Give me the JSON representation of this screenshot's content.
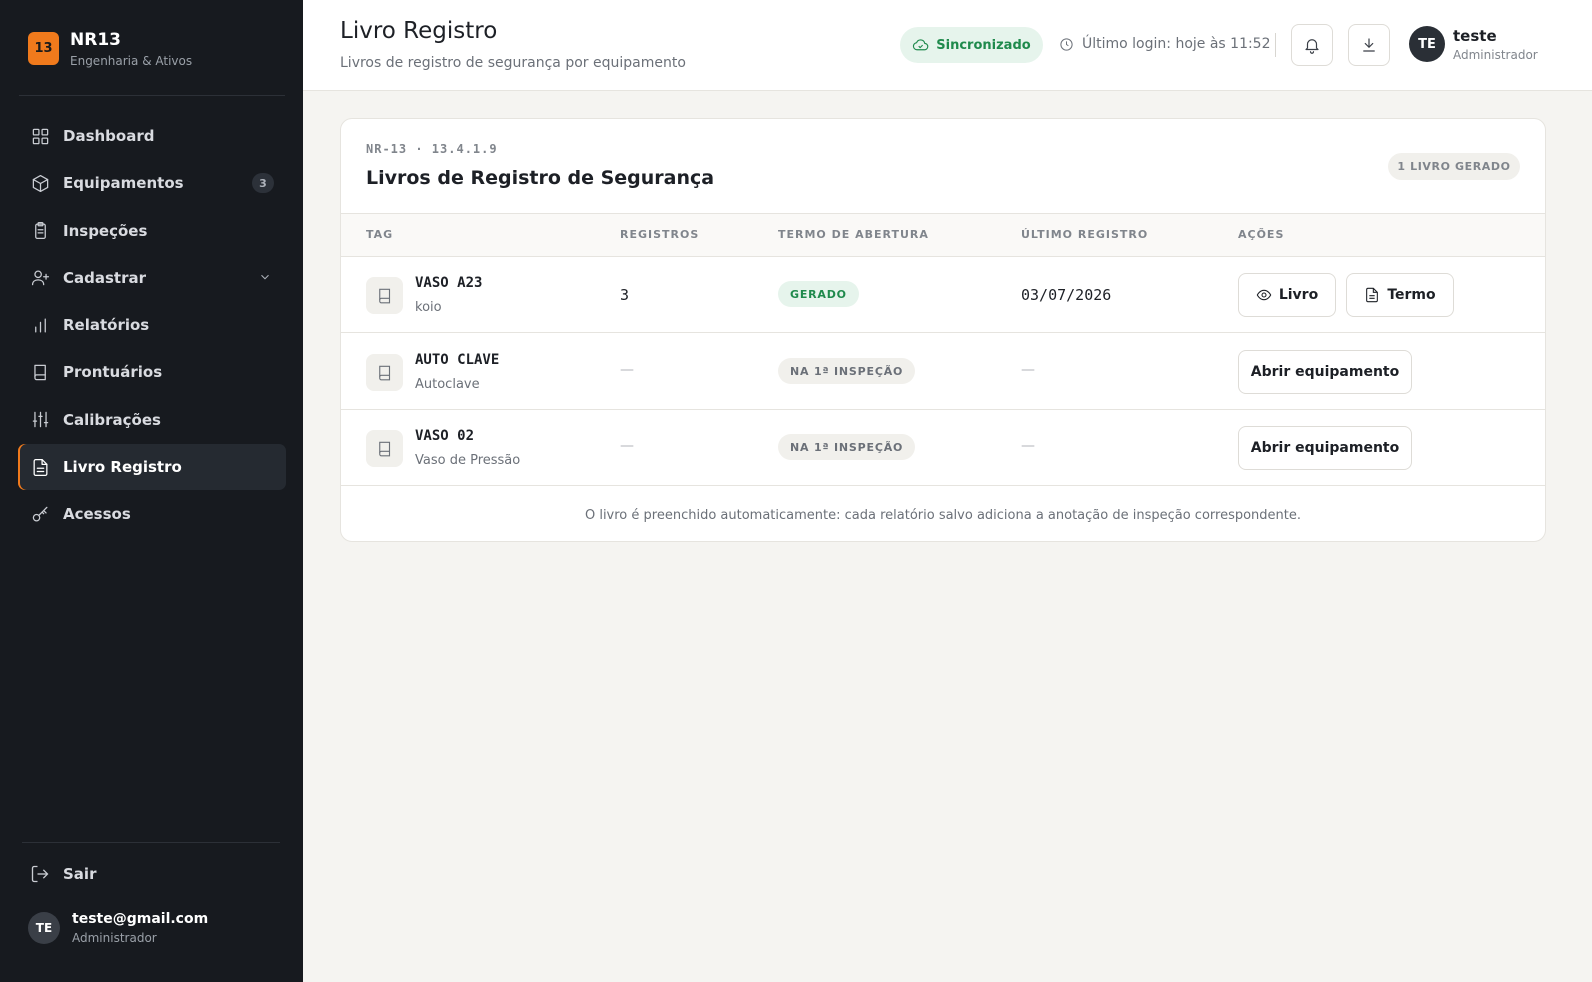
{
  "brand": {
    "logo_text": "13",
    "name": "NR13",
    "subtitle": "Engenharia & Ativos"
  },
  "sidebar": {
    "items": [
      {
        "label": "Dashboard",
        "icon": "dashboard-icon"
      },
      {
        "label": "Equipamentos",
        "icon": "box-icon",
        "badge": "3"
      },
      {
        "label": "Inspeções",
        "icon": "clipboard-icon"
      },
      {
        "label": "Cadastrar",
        "icon": "user-plus-icon",
        "expandable": true
      },
      {
        "label": "Relatórios",
        "icon": "bar-chart-icon"
      },
      {
        "label": "Prontuários",
        "icon": "book-icon"
      },
      {
        "label": "Calibrações",
        "icon": "sliders-icon"
      },
      {
        "label": "Livro Registro",
        "icon": "file-text-icon",
        "active": true
      },
      {
        "label": "Acessos",
        "icon": "key-icon"
      }
    ],
    "logout_label": "Sair",
    "user": {
      "initials": "TE",
      "email": "teste@gmail.com",
      "role": "Administrador"
    }
  },
  "header": {
    "title": "Livro Registro",
    "subtitle": "Livros de registro de segurança por equipamento",
    "sync_label": "Sincronizado",
    "last_login": "Último login: hoje às 11:52",
    "user": {
      "initials": "TE",
      "name": "teste",
      "role": "Administrador"
    }
  },
  "card": {
    "eyebrow": "NR-13 · 13.4.1.9",
    "title": "Livros de Registro de Segurança",
    "pill": "1 LIVRO GERADO",
    "columns": [
      "TAG",
      "REGISTROS",
      "TERMO DE ABERTURA",
      "ÚLTIMO REGISTRO",
      "AÇÕES"
    ],
    "rows": [
      {
        "tag": "VASO A23",
        "desc": "koio",
        "registros": "3",
        "termo": "GERADO",
        "ultimo": "03/07/2026",
        "actions": [
          "Livro",
          "Termo"
        ]
      },
      {
        "tag": "AUTO CLAVE",
        "desc": "Autoclave",
        "registros": "—",
        "termo": "NA 1ª INSPEÇÃO",
        "ultimo": "—",
        "actions": [
          "Abrir equipamento"
        ]
      },
      {
        "tag": "VASO 02",
        "desc": "Vaso de Pressão",
        "registros": "—",
        "termo": "NA 1ª INSPEÇÃO",
        "ultimo": "—",
        "actions": [
          "Abrir equipamento"
        ]
      }
    ],
    "footer": "O livro é preenchido automaticamente: cada relatório salvo adiciona a anotação de inspeção correspondente."
  },
  "colors": {
    "accent": "#f07a1c",
    "sidebar_bg": "#171a1f",
    "success": "#1f8a4c"
  }
}
